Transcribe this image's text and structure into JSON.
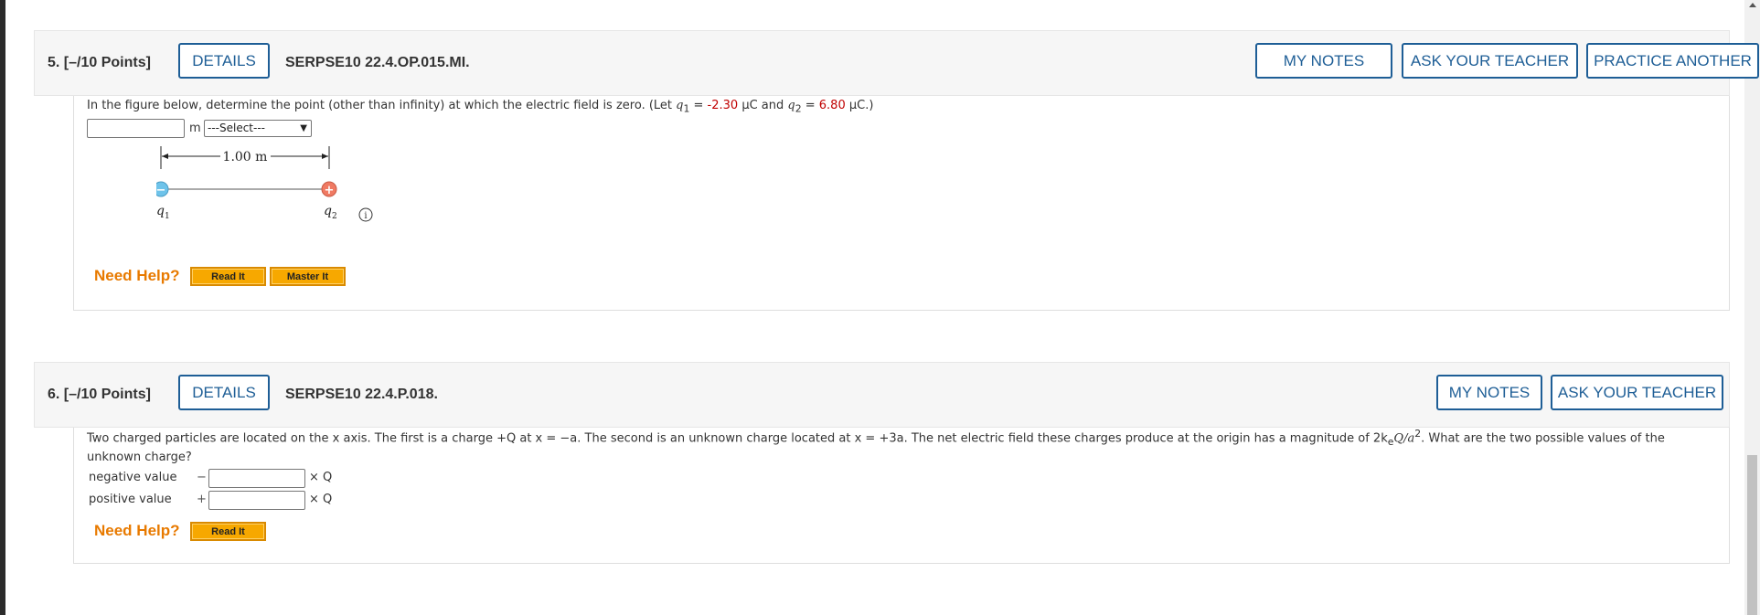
{
  "questions": [
    {
      "number": "5.",
      "points": "[–/10 Points]",
      "details_label": "DETAILS",
      "code": "SERPSE10 22.4.OP.015.MI.",
      "actions": [
        "MY NOTES",
        "ASK YOUR TEACHER",
        "PRACTICE ANOTHER"
      ],
      "prompt_start": "In the figure below, determine the point (other than infinity) at which the electric field is zero. (Let ",
      "q1_symbol": "q",
      "q1_sub": "1",
      "eq": " = ",
      "q1_value": "-2.30",
      "unit_uc": " μC and ",
      "q2_symbol": "q",
      "q2_sub": "2",
      "q2_value": "6.80",
      "prompt_end": " μC.)",
      "answer_value": "",
      "answer_unit": "m",
      "select_value": "---Select---",
      "figure": {
        "distance_label": "1.00 m",
        "q1_label": "q",
        "q1_sub": "1",
        "q2_label": "q",
        "q2_sub": "2",
        "q1_sign": "−",
        "q2_sign": "+",
        "info_icon": "i"
      },
      "need_help": "Need Help?",
      "help_buttons": [
        "Read It",
        "Master It"
      ]
    },
    {
      "number": "6.",
      "points": "[–/10 Points]",
      "details_label": "DETAILS",
      "code": "SERPSE10 22.4.P.018.",
      "actions": [
        "MY NOTES",
        "ASK YOUR TEACHER"
      ],
      "prompt_line1": "Two charged particles are located on the x axis. The first is a charge +Q at x = −a. The second is an unknown charge located at x = +3a. The net electric field these charges produce at the origin has a magnitude of 2k",
      "prompt_sub_e": "e",
      "prompt_q_over": "Q/a",
      "prompt_sup": "2",
      "prompt_line1_end": ". What are the two possible values of the",
      "prompt_line2": "unknown charge?",
      "rows": [
        {
          "label": "negative value",
          "sign": "−",
          "value": "",
          "suffix": "× Q"
        },
        {
          "label": "positive value",
          "sign": "+",
          "value": "",
          "suffix": "× Q"
        }
      ],
      "need_help": "Need Help?",
      "help_buttons": [
        "Read It"
      ]
    }
  ],
  "colors": {
    "accent_blue": "#1e5e96",
    "help_orange": "#e87a00",
    "value_red": "#c00000",
    "negative_charge": "#6ec3ea",
    "positive_charge": "#f07a63"
  }
}
